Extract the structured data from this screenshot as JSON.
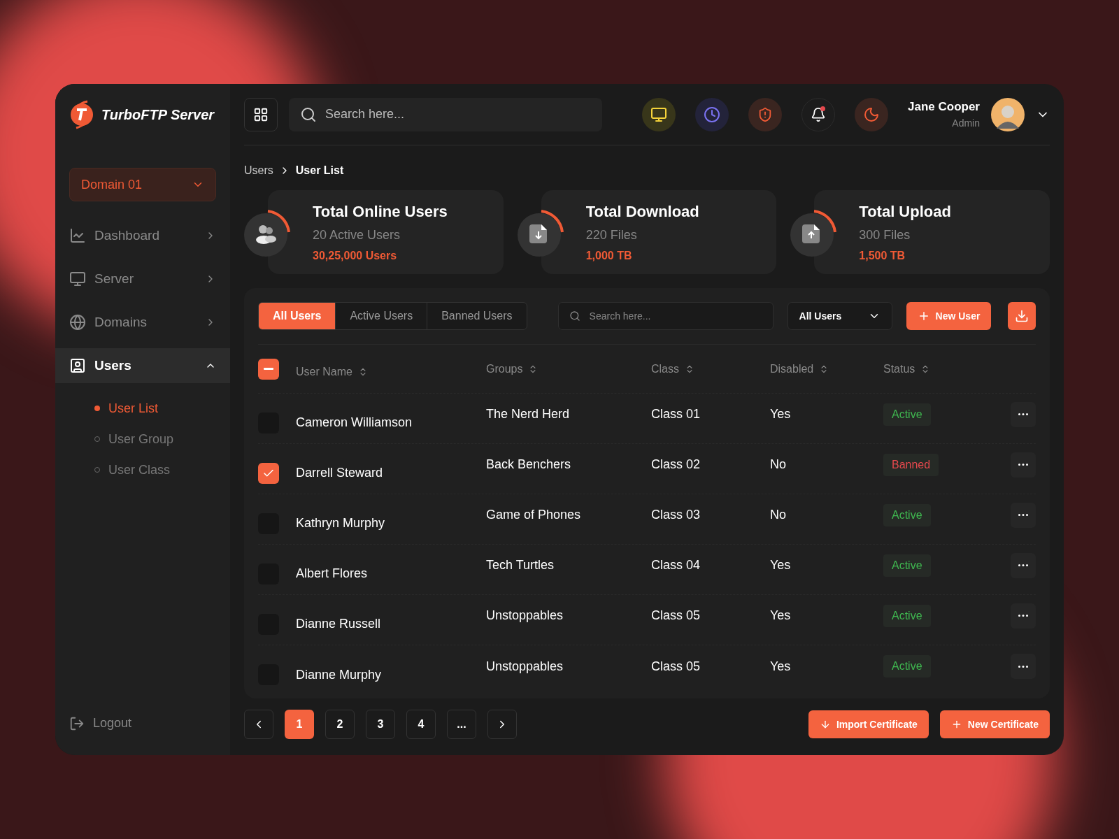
{
  "brand": "TurboFTP Server",
  "domain_select": {
    "value": "Domain 01"
  },
  "nav": [
    {
      "label": "Dashboard",
      "kind": "chart",
      "expanded": false,
      "selected": false
    },
    {
      "label": "Server",
      "kind": "monitor",
      "expanded": false,
      "selected": false
    },
    {
      "label": "Domains",
      "kind": "globe",
      "expanded": false,
      "selected": false
    },
    {
      "label": "Users",
      "kind": "user",
      "expanded": true,
      "selected": true,
      "children": [
        {
          "label": "User List",
          "selected": true
        },
        {
          "label": "User Group",
          "selected": false
        },
        {
          "label": "User Class",
          "selected": false
        }
      ]
    }
  ],
  "logout": "Logout",
  "top_search": {
    "placeholder": "Search here..."
  },
  "user": {
    "name": "Jane Cooper",
    "role": "Admin"
  },
  "notification_unread": true,
  "breadcrumb": [
    "Users",
    "User List"
  ],
  "stats": [
    {
      "title": "Total Online Users",
      "line1": "20 Active Users",
      "line2": "30,25,000 Users",
      "kind": "users"
    },
    {
      "title": "Total Download",
      "line1": "220 Files",
      "line2": "1,000 TB",
      "kind": "download"
    },
    {
      "title": "Total Upload",
      "line1": "300 Files",
      "line2": "1,500 TB",
      "kind": "upload"
    }
  ],
  "tabs": [
    {
      "label": "All Users",
      "selected": true
    },
    {
      "label": "Active Users",
      "selected": false
    },
    {
      "label": "Banned Users",
      "selected": false
    }
  ],
  "table_search": {
    "placeholder": "Search here..."
  },
  "filter_select": {
    "value": "All Users"
  },
  "new_user_button": "New User",
  "select_all_partial": true,
  "columns": [
    "User Name",
    "Groups",
    "Class",
    "Disabled",
    "Status"
  ],
  "rows": [
    {
      "name": "Cameron Williamson",
      "group": "The Nerd Herd",
      "class": "Class 01",
      "disabled": "Yes",
      "status": "Active",
      "color": "#3fb950",
      "checked": false
    },
    {
      "name": "Darrell Steward",
      "group": "Back Benchers",
      "class": "Class 02",
      "disabled": "No",
      "status": "Banned",
      "color": "#e5484d",
      "checked": true
    },
    {
      "name": "Kathryn Murphy",
      "group": "Game of Phones",
      "class": "Class 03",
      "disabled": "No",
      "status": "Active",
      "color": "#3fb950",
      "checked": false
    },
    {
      "name": "Albert Flores",
      "group": "Tech Turtles",
      "class": "Class 04",
      "disabled": "Yes",
      "status": "Active",
      "color": "#3fb950",
      "checked": false
    },
    {
      "name": "Dianne Russell",
      "group": "Unstoppables",
      "class": "Class 05",
      "disabled": "Yes",
      "status": "Active",
      "color": "#3fb950",
      "checked": false
    },
    {
      "name": "Dianne Murphy",
      "group": "Unstoppables",
      "class": "Class 05",
      "disabled": "Yes",
      "status": "Active",
      "color": "#3fb950",
      "checked": false
    }
  ],
  "pages": [
    {
      "label": "1",
      "selected": true
    },
    {
      "label": "2",
      "selected": false
    },
    {
      "label": "3",
      "selected": false
    },
    {
      "label": "4",
      "selected": false
    },
    {
      "label": "...",
      "selected": false
    }
  ],
  "import_button": "Import Certificate",
  "new_certificate_button": "New Certificate"
}
